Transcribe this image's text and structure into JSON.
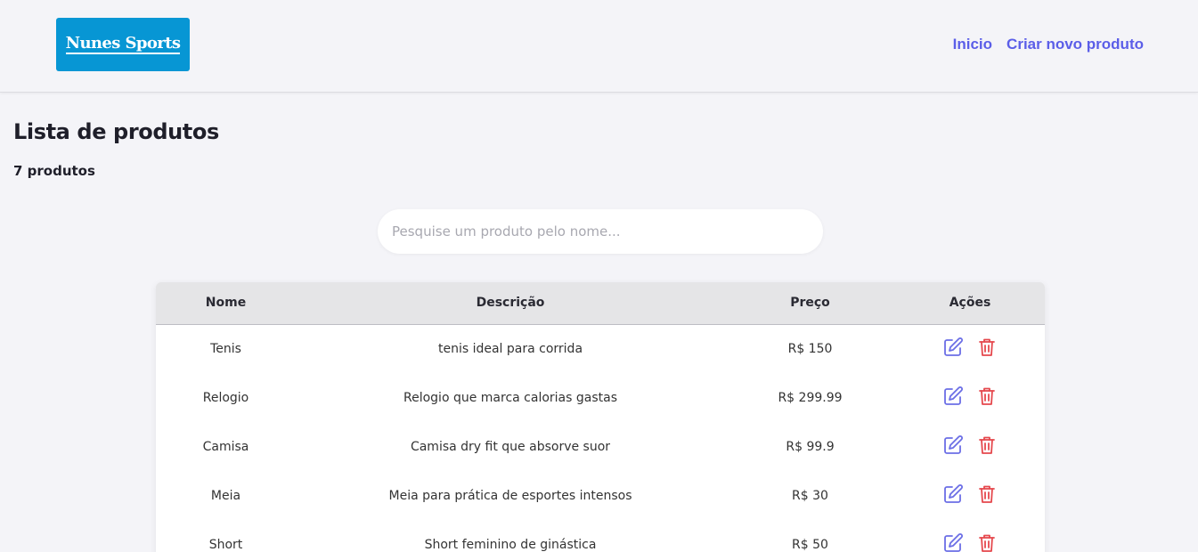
{
  "header": {
    "logo_text": "Nunes Sports",
    "nav": [
      {
        "label": "Inicio"
      },
      {
        "label": "Criar novo produto"
      }
    ]
  },
  "main": {
    "title": "Lista de produtos",
    "count_label": "7 produtos",
    "search": {
      "placeholder": "Pesquise um produto pelo nome...",
      "value": ""
    },
    "table": {
      "columns": [
        "Nome",
        "Descrição",
        "Preço",
        "Ações"
      ],
      "rows": [
        {
          "name": "Tenis",
          "description": "tenis ideal para corrida",
          "price": "R$ 150"
        },
        {
          "name": "Relogio",
          "description": "Relogio que marca calorias gastas",
          "price": "R$ 299.99"
        },
        {
          "name": "Camisa",
          "description": "Camisa dry fit que absorve suor",
          "price": "R$ 99.9"
        },
        {
          "name": "Meia",
          "description": "Meia para prática de esportes intensos",
          "price": "R$ 30"
        },
        {
          "name": "Short",
          "description": "Short feminino de ginástica",
          "price": "R$ 50"
        }
      ]
    }
  },
  "colors": {
    "accent": "#5b5ee8",
    "logo_bg": "#0796d4",
    "delete": "#e5484d",
    "edit": "#6b6ee6"
  },
  "icons": {
    "edit": "edit-icon",
    "delete": "trash-icon"
  }
}
